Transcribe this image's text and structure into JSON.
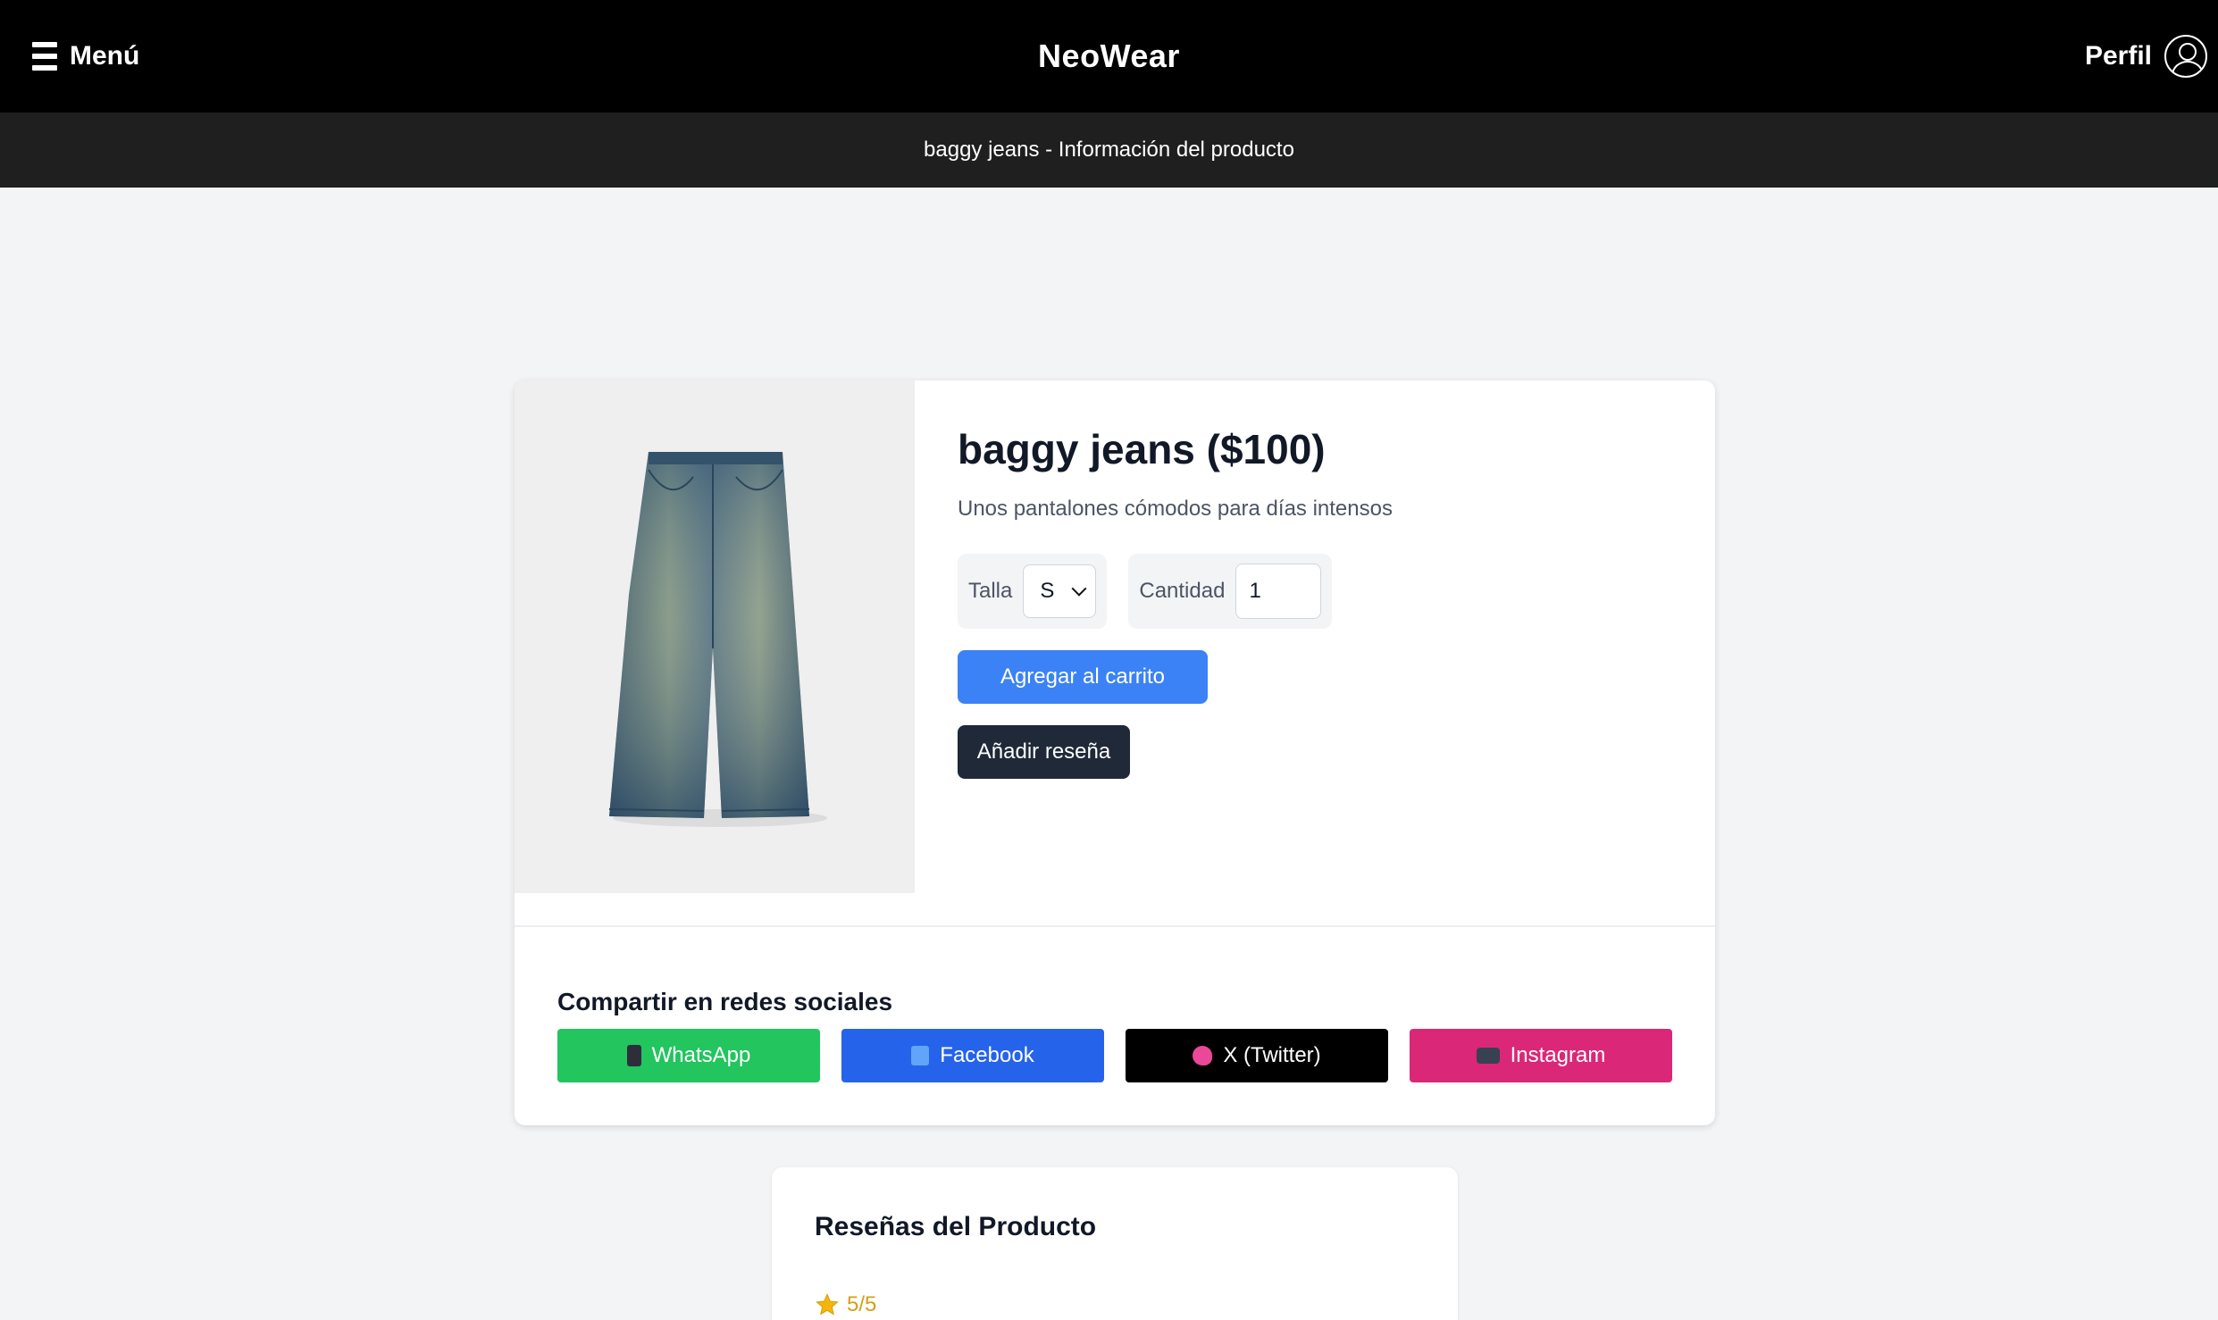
{
  "header": {
    "menu_label": "Menú",
    "brand": "NeoWear",
    "profile_label": "Perfil"
  },
  "subheader": {
    "text": "baggy jeans - Información del producto"
  },
  "product": {
    "title": "baggy jeans ($100)",
    "description": "Unos pantalones cómodos para días intensos",
    "size_label": "Talla",
    "size_value": "S",
    "quantity_label": "Cantidad",
    "quantity_value": "1",
    "add_to_cart_label": "Agregar al carrito",
    "add_review_label": "Añadir reseña",
    "image_icon": "jeans-image"
  },
  "share": {
    "title": "Compartir en redes sociales",
    "buttons": [
      {
        "label": "WhatsApp",
        "color": "#22c55e",
        "icon": "phone-icon"
      },
      {
        "label": "Facebook",
        "color": "#2563eb",
        "icon": "book-icon"
      },
      {
        "label": "X (Twitter)",
        "color": "#000000",
        "icon": "bird-icon"
      },
      {
        "label": "Instagram",
        "color": "#db2777",
        "icon": "camera-icon"
      }
    ]
  },
  "reviews": {
    "title": "Reseñas del Producto",
    "rating_text": "5/5"
  }
}
